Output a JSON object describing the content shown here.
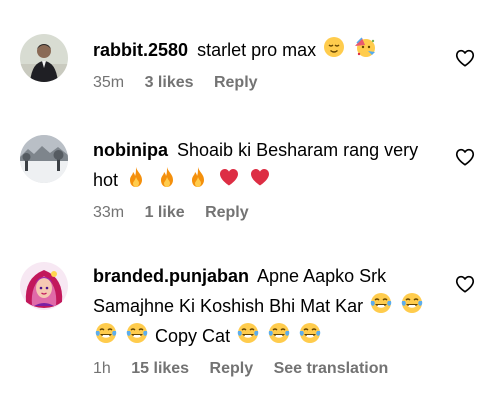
{
  "comments": [
    {
      "username": "rabbit.2580",
      "text": "starlet pro max",
      "emojis": [
        "relieved-face",
        "partying-face"
      ],
      "time": "35m",
      "likes": "3 likes",
      "reply": "Reply"
    },
    {
      "username": "nobinipa",
      "text": "Shoaib ki Besharam rang very hot",
      "emojis": [
        "fire",
        "fire",
        "fire",
        "red-heart",
        "red-heart"
      ],
      "time": "33m",
      "likes": "1 like",
      "reply": "Reply"
    },
    {
      "username": "branded.punjaban",
      "text_part1": "Apne Aapko Srk Samajhne Ki Koshish Bhi Mat Kar",
      "text_part2": "Copy Cat",
      "emojis_part1": [
        "face-with-tears-of-joy",
        "face-with-tears-of-joy",
        "face-with-tears-of-joy",
        "face-with-tears-of-joy"
      ],
      "emojis_part2": [
        "face-with-tears-of-joy",
        "face-with-tears-of-joy",
        "face-with-tears-of-joy"
      ],
      "time": "1h",
      "likes": "15 likes",
      "reply": "Reply",
      "see_translation": "See translation"
    }
  ],
  "icons": {
    "like": "heart-outline-icon"
  },
  "colors": {
    "meta_text": "#737373",
    "primary_text": "#000000",
    "heart_red": "#ff3040",
    "fire_orange": "#f4900c"
  }
}
